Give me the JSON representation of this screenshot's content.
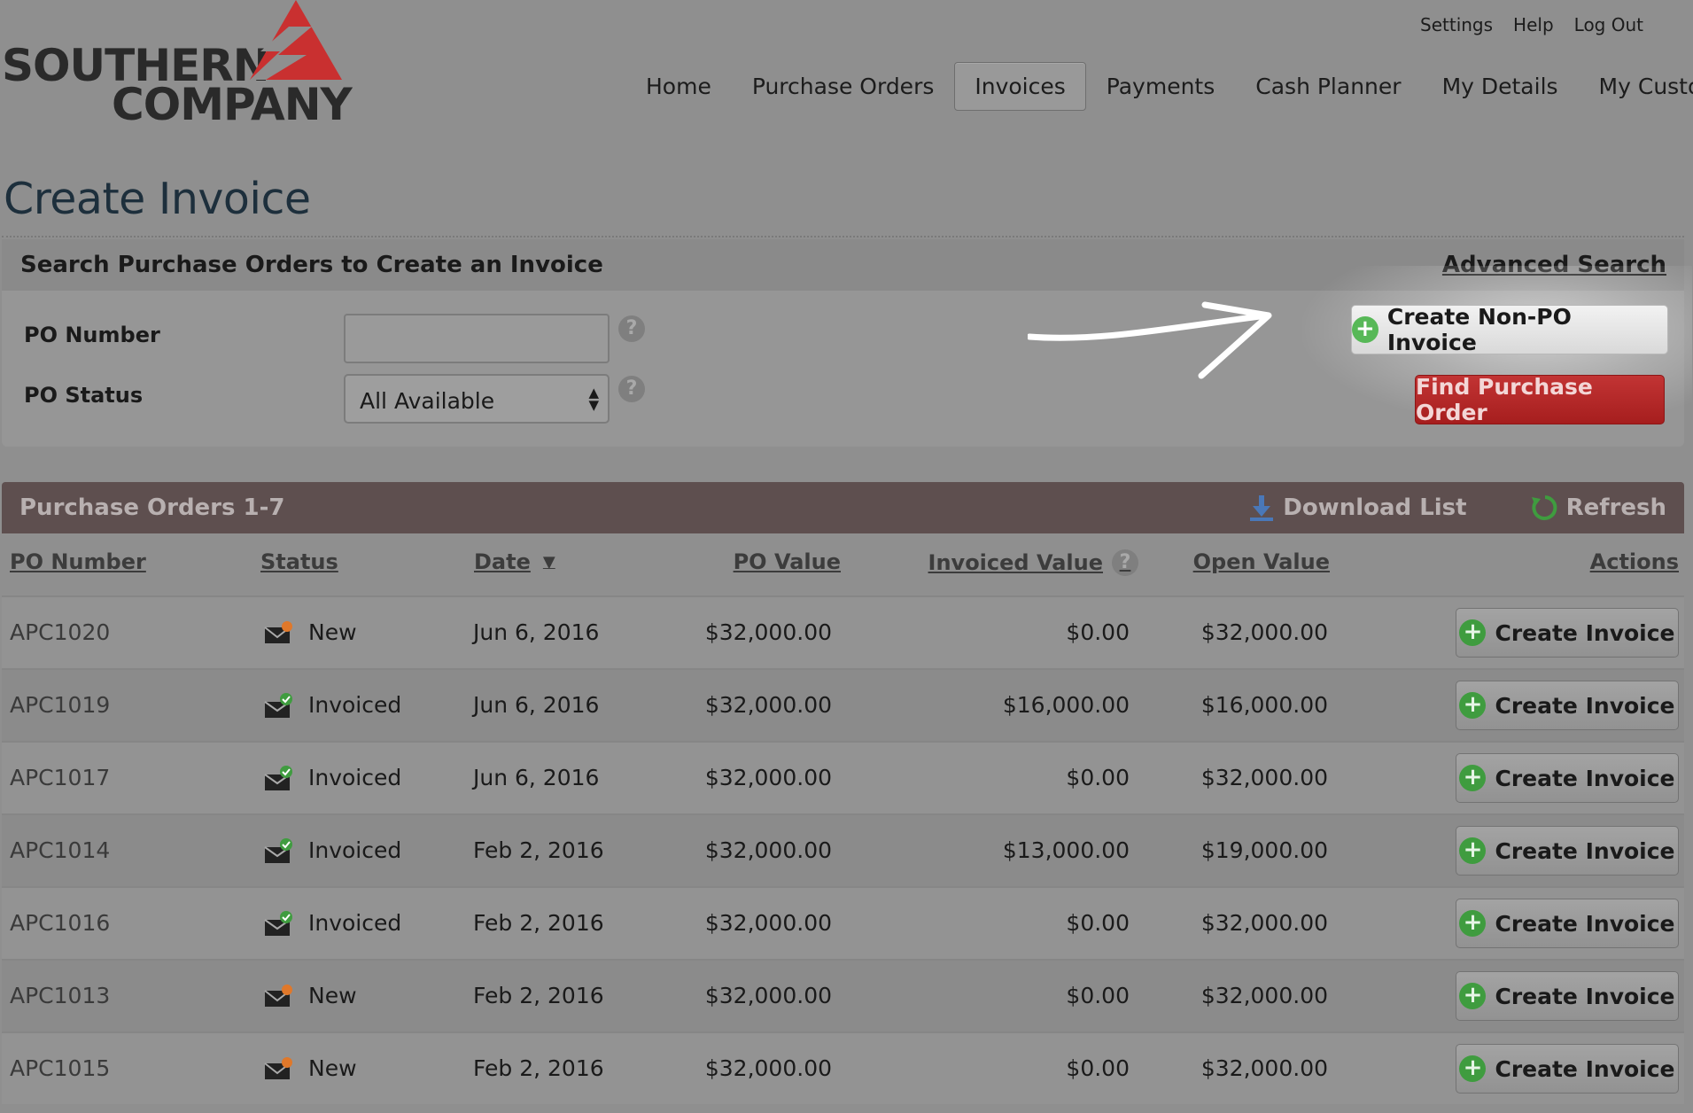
{
  "brand": {
    "line1": "SOUTHERN",
    "line2": "COMPANY",
    "accent": "#d42b2b"
  },
  "util_links": [
    "Settings",
    "Help",
    "Log Out"
  ],
  "nav": {
    "items": [
      "Home",
      "Purchase Orders",
      "Invoices",
      "Payments",
      "Cash Planner",
      "My Details",
      "My Customer"
    ],
    "active": "Invoices"
  },
  "page_title": "Create Invoice",
  "search": {
    "title": "Search Purchase Orders to Create an Invoice",
    "advanced": "Advanced Search",
    "po_number_label": "PO Number",
    "po_number_value": "",
    "po_status_label": "PO Status",
    "po_status_value": "All Available",
    "help_glyph": "?",
    "create_nonpo": "Create Non-PO Invoice",
    "find": "Find Purchase Order"
  },
  "list": {
    "title": "Purchase Orders 1-7",
    "download": "Download List",
    "refresh": "Refresh",
    "columns": {
      "po_number": "PO Number",
      "status": "Status",
      "date": "Date",
      "po_value": "PO Value",
      "invoiced_value": "Invoiced Value",
      "open_value": "Open Value",
      "actions": "Actions"
    },
    "action_label": "Create Invoice",
    "rows": [
      {
        "po": "APC1020",
        "status": "New",
        "icon": "new-envelope-icon",
        "date": "Jun 6, 2016",
        "po_value": "$32,000.00",
        "invoiced": "$0.00",
        "open": "$32,000.00"
      },
      {
        "po": "APC1019",
        "status": "Invoiced",
        "icon": "invoiced-envelope-icon",
        "date": "Jun 6, 2016",
        "po_value": "$32,000.00",
        "invoiced": "$16,000.00",
        "open": "$16,000.00"
      },
      {
        "po": "APC1017",
        "status": "Invoiced",
        "icon": "invoiced-envelope-icon",
        "date": "Jun 6, 2016",
        "po_value": "$32,000.00",
        "invoiced": "$0.00",
        "open": "$32,000.00"
      },
      {
        "po": "APC1014",
        "status": "Invoiced",
        "icon": "invoiced-envelope-icon",
        "date": "Feb 2, 2016",
        "po_value": "$32,000.00",
        "invoiced": "$13,000.00",
        "open": "$19,000.00"
      },
      {
        "po": "APC1016",
        "status": "Invoiced",
        "icon": "invoiced-envelope-icon",
        "date": "Feb 2, 2016",
        "po_value": "$32,000.00",
        "invoiced": "$0.00",
        "open": "$32,000.00"
      },
      {
        "po": "APC1013",
        "status": "New",
        "icon": "new-envelope-icon",
        "date": "Feb 2, 2016",
        "po_value": "$32,000.00",
        "invoiced": "$0.00",
        "open": "$32,000.00"
      },
      {
        "po": "APC1015",
        "status": "New",
        "icon": "new-envelope-icon",
        "date": "Feb 2, 2016",
        "po_value": "$32,000.00",
        "invoiced": "$0.00",
        "open": "$32,000.00"
      }
    ]
  }
}
